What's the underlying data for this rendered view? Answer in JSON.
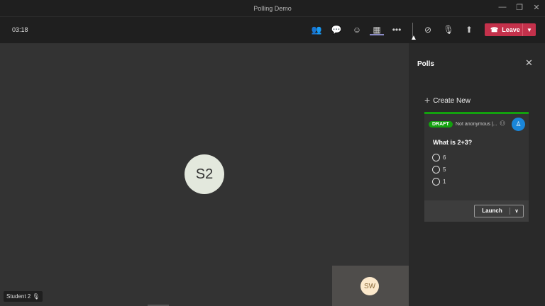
{
  "window": {
    "title": "Polling Demo",
    "minimize": "—",
    "restore": "❐",
    "close": "✕"
  },
  "toolbar": {
    "timer": "03:18",
    "leave_label": "Leave",
    "icons": [
      "people-icon",
      "chat-icon",
      "reactions-icon",
      "apps-icon",
      "more-icon",
      "camera-off-icon",
      "mic-off-icon",
      "share-icon"
    ]
  },
  "stage": {
    "participant_initials": "S2",
    "participant_name": "Student 2",
    "self_initials": "SW"
  },
  "polls": {
    "title": "Polls",
    "create_new": "Create New",
    "card": {
      "status": "DRAFT",
      "meta": "Not anonymous |...",
      "question": "What is 2+3?",
      "options": [
        "6",
        "5",
        "1"
      ],
      "launch": "Launch"
    }
  },
  "colors": {
    "leave": "#c4314b",
    "draft": "#13a10e",
    "avatar": "#1a86d9"
  }
}
